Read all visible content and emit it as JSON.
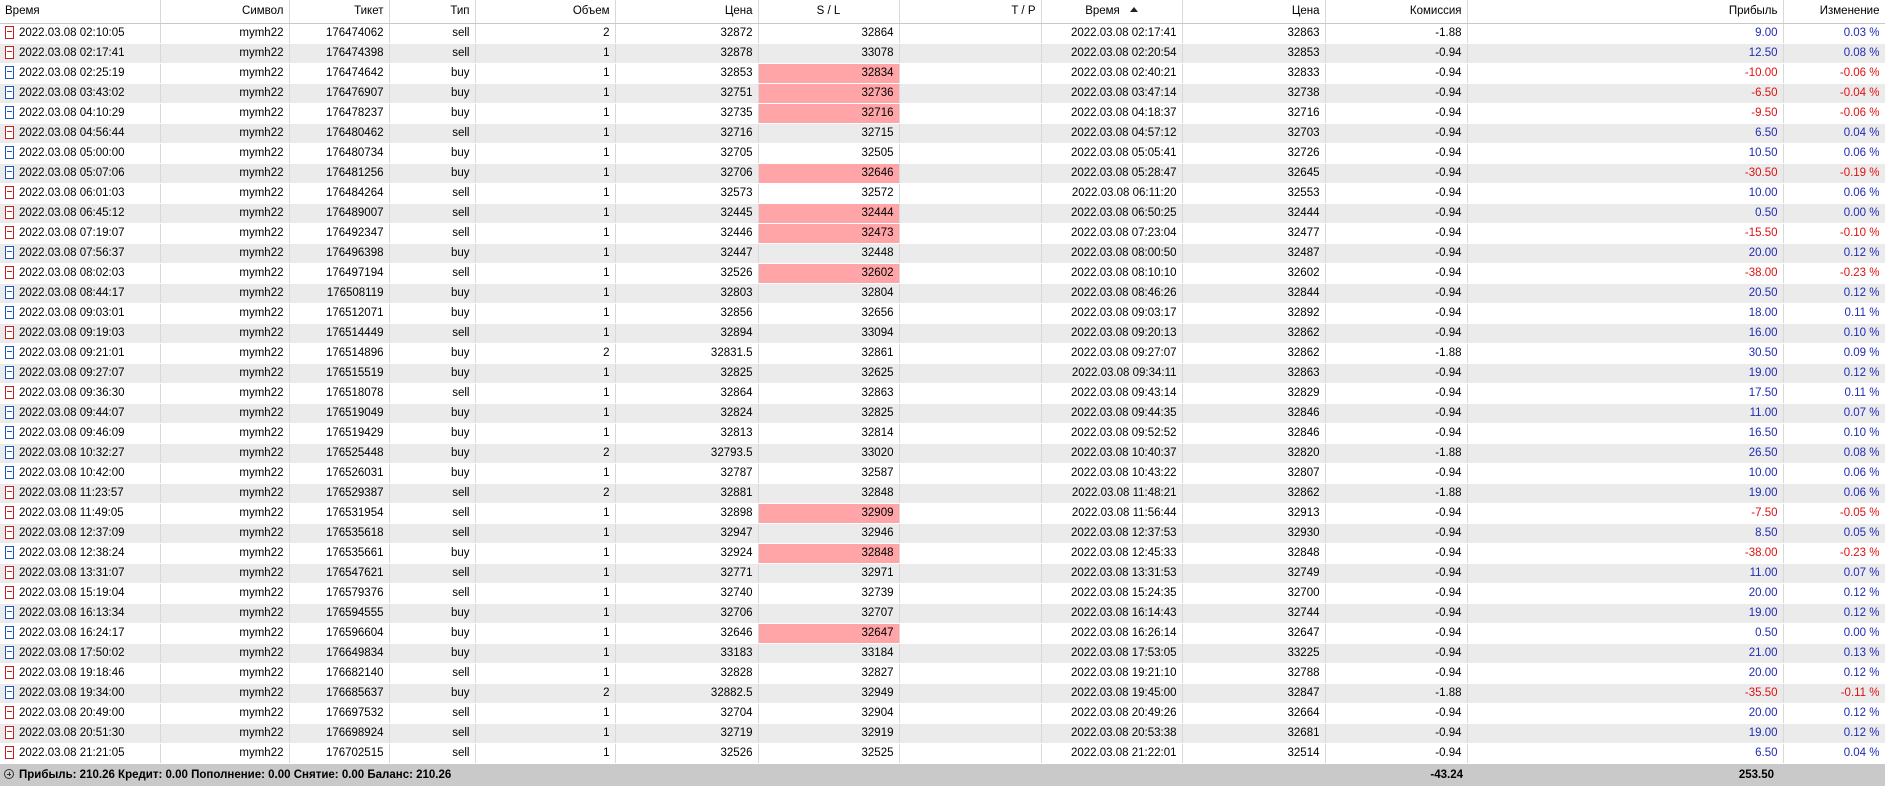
{
  "columns": [
    {
      "key": "open_time",
      "label": "Время"
    },
    {
      "key": "symbol",
      "label": "Символ"
    },
    {
      "key": "ticket",
      "label": "Тикет"
    },
    {
      "key": "type",
      "label": "Тип"
    },
    {
      "key": "volume",
      "label": "Объем"
    },
    {
      "key": "open_price",
      "label": "Цена"
    },
    {
      "key": "sl",
      "label": "S / L"
    },
    {
      "key": "tp",
      "label": "T / P"
    },
    {
      "key": "close_time",
      "label": "Время"
    },
    {
      "key": "close_price",
      "label": "Цена"
    },
    {
      "key": "commission",
      "label": "Комиссия"
    },
    {
      "key": "profit",
      "label": "Прибыль"
    },
    {
      "key": "change",
      "label": "Изменение"
    }
  ],
  "colors": {
    "sl_hit": "#ffa5a8",
    "profit_pos": "#1f2bb4",
    "profit_neg": "#e01010",
    "sell_icon": "#c32121",
    "buy_icon": "#1d55b8"
  },
  "rows": [
    [
      "2022.03.08 02:10:05",
      "mymh22",
      "176474062",
      "sell",
      "2",
      "32872",
      "32864",
      "",
      "2022.03.08 02:17:41",
      "32863",
      "-1.88",
      "9.00",
      "0.03 %",
      false
    ],
    [
      "2022.03.08 02:17:41",
      "mymh22",
      "176474398",
      "sell",
      "1",
      "32878",
      "33078",
      "",
      "2022.03.08 02:20:54",
      "32853",
      "-0.94",
      "12.50",
      "0.08 %",
      false
    ],
    [
      "2022.03.08 02:25:19",
      "mymh22",
      "176474642",
      "buy",
      "1",
      "32853",
      "32834",
      "",
      "2022.03.08 02:40:21",
      "32833",
      "-0.94",
      "-10.00",
      "-0.06 %",
      true
    ],
    [
      "2022.03.08 03:43:02",
      "mymh22",
      "176476907",
      "buy",
      "1",
      "32751",
      "32736",
      "",
      "2022.03.08 03:47:14",
      "32738",
      "-0.94",
      "-6.50",
      "-0.04 %",
      true
    ],
    [
      "2022.03.08 04:10:29",
      "mymh22",
      "176478237",
      "buy",
      "1",
      "32735",
      "32716",
      "",
      "2022.03.08 04:18:37",
      "32716",
      "-0.94",
      "-9.50",
      "-0.06 %",
      true
    ],
    [
      "2022.03.08 04:56:44",
      "mymh22",
      "176480462",
      "sell",
      "1",
      "32716",
      "32715",
      "",
      "2022.03.08 04:57:12",
      "32703",
      "-0.94",
      "6.50",
      "0.04 %",
      false
    ],
    [
      "2022.03.08 05:00:00",
      "mymh22",
      "176480734",
      "buy",
      "1",
      "32705",
      "32505",
      "",
      "2022.03.08 05:05:41",
      "32726",
      "-0.94",
      "10.50",
      "0.06 %",
      false
    ],
    [
      "2022.03.08 05:07:06",
      "mymh22",
      "176481256",
      "buy",
      "1",
      "32706",
      "32646",
      "",
      "2022.03.08 05:28:47",
      "32645",
      "-0.94",
      "-30.50",
      "-0.19 %",
      true
    ],
    [
      "2022.03.08 06:01:03",
      "mymh22",
      "176484264",
      "sell",
      "1",
      "32573",
      "32572",
      "",
      "2022.03.08 06:11:20",
      "32553",
      "-0.94",
      "10.00",
      "0.06 %",
      false
    ],
    [
      "2022.03.08 06:45:12",
      "mymh22",
      "176489007",
      "sell",
      "1",
      "32445",
      "32444",
      "",
      "2022.03.08 06:50:25",
      "32444",
      "-0.94",
      "0.50",
      "0.00 %",
      true
    ],
    [
      "2022.03.08 07:19:07",
      "mymh22",
      "176492347",
      "sell",
      "1",
      "32446",
      "32473",
      "",
      "2022.03.08 07:23:04",
      "32477",
      "-0.94",
      "-15.50",
      "-0.10 %",
      true
    ],
    [
      "2022.03.08 07:56:37",
      "mymh22",
      "176496398",
      "buy",
      "1",
      "32447",
      "32448",
      "",
      "2022.03.08 08:00:50",
      "32487",
      "-0.94",
      "20.00",
      "0.12 %",
      false
    ],
    [
      "2022.03.08 08:02:03",
      "mymh22",
      "176497194",
      "sell",
      "1",
      "32526",
      "32602",
      "",
      "2022.03.08 08:10:10",
      "32602",
      "-0.94",
      "-38.00",
      "-0.23 %",
      true
    ],
    [
      "2022.03.08 08:44:17",
      "mymh22",
      "176508119",
      "buy",
      "1",
      "32803",
      "32804",
      "",
      "2022.03.08 08:46:26",
      "32844",
      "-0.94",
      "20.50",
      "0.12 %",
      false
    ],
    [
      "2022.03.08 09:03:01",
      "mymh22",
      "176512071",
      "buy",
      "1",
      "32856",
      "32656",
      "",
      "2022.03.08 09:03:17",
      "32892",
      "-0.94",
      "18.00",
      "0.11 %",
      false
    ],
    [
      "2022.03.08 09:19:03",
      "mymh22",
      "176514449",
      "sell",
      "1",
      "32894",
      "33094",
      "",
      "2022.03.08 09:20:13",
      "32862",
      "-0.94",
      "16.00",
      "0.10 %",
      false
    ],
    [
      "2022.03.08 09:21:01",
      "mymh22",
      "176514896",
      "buy",
      "2",
      "32831.5",
      "32861",
      "",
      "2022.03.08 09:27:07",
      "32862",
      "-1.88",
      "30.50",
      "0.09 %",
      false
    ],
    [
      "2022.03.08 09:27:07",
      "mymh22",
      "176515519",
      "buy",
      "1",
      "32825",
      "32625",
      "",
      "2022.03.08 09:34:11",
      "32863",
      "-0.94",
      "19.00",
      "0.12 %",
      false
    ],
    [
      "2022.03.08 09:36:30",
      "mymh22",
      "176518078",
      "sell",
      "1",
      "32864",
      "32863",
      "",
      "2022.03.08 09:43:14",
      "32829",
      "-0.94",
      "17.50",
      "0.11 %",
      false
    ],
    [
      "2022.03.08 09:44:07",
      "mymh22",
      "176519049",
      "buy",
      "1",
      "32824",
      "32825",
      "",
      "2022.03.08 09:44:35",
      "32846",
      "-0.94",
      "11.00",
      "0.07 %",
      false
    ],
    [
      "2022.03.08 09:46:09",
      "mymh22",
      "176519429",
      "buy",
      "1",
      "32813",
      "32814",
      "",
      "2022.03.08 09:52:52",
      "32846",
      "-0.94",
      "16.50",
      "0.10 %",
      false
    ],
    [
      "2022.03.08 10:32:27",
      "mymh22",
      "176525448",
      "buy",
      "2",
      "32793.5",
      "33020",
      "",
      "2022.03.08 10:40:37",
      "32820",
      "-1.88",
      "26.50",
      "0.08 %",
      false
    ],
    [
      "2022.03.08 10:42:00",
      "mymh22",
      "176526031",
      "buy",
      "1",
      "32787",
      "32587",
      "",
      "2022.03.08 10:43:22",
      "32807",
      "-0.94",
      "10.00",
      "0.06 %",
      false
    ],
    [
      "2022.03.08 11:23:57",
      "mymh22",
      "176529387",
      "sell",
      "2",
      "32881",
      "32848",
      "",
      "2022.03.08 11:48:21",
      "32862",
      "-1.88",
      "19.00",
      "0.06 %",
      false
    ],
    [
      "2022.03.08 11:49:05",
      "mymh22",
      "176531954",
      "sell",
      "1",
      "32898",
      "32909",
      "",
      "2022.03.08 11:56:44",
      "32913",
      "-0.94",
      "-7.50",
      "-0.05 %",
      true
    ],
    [
      "2022.03.08 12:37:09",
      "mymh22",
      "176535618",
      "sell",
      "1",
      "32947",
      "32946",
      "",
      "2022.03.08 12:37:53",
      "32930",
      "-0.94",
      "8.50",
      "0.05 %",
      false
    ],
    [
      "2022.03.08 12:38:24",
      "mymh22",
      "176535661",
      "buy",
      "1",
      "32924",
      "32848",
      "",
      "2022.03.08 12:45:33",
      "32848",
      "-0.94",
      "-38.00",
      "-0.23 %",
      true
    ],
    [
      "2022.03.08 13:31:07",
      "mymh22",
      "176547621",
      "sell",
      "1",
      "32771",
      "32971",
      "",
      "2022.03.08 13:31:53",
      "32749",
      "-0.94",
      "11.00",
      "0.07 %",
      false
    ],
    [
      "2022.03.08 15:19:04",
      "mymh22",
      "176579376",
      "sell",
      "1",
      "32740",
      "32739",
      "",
      "2022.03.08 15:24:35",
      "32700",
      "-0.94",
      "20.00",
      "0.12 %",
      false
    ],
    [
      "2022.03.08 16:13:34",
      "mymh22",
      "176594555",
      "buy",
      "1",
      "32706",
      "32707",
      "",
      "2022.03.08 16:14:43",
      "32744",
      "-0.94",
      "19.00",
      "0.12 %",
      false
    ],
    [
      "2022.03.08 16:24:17",
      "mymh22",
      "176596604",
      "buy",
      "1",
      "32646",
      "32647",
      "",
      "2022.03.08 16:26:14",
      "32647",
      "-0.94",
      "0.50",
      "0.00 %",
      true
    ],
    [
      "2022.03.08 17:50:02",
      "mymh22",
      "176649834",
      "buy",
      "1",
      "33183",
      "33184",
      "",
      "2022.03.08 17:53:05",
      "33225",
      "-0.94",
      "21.00",
      "0.13 %",
      false
    ],
    [
      "2022.03.08 19:18:46",
      "mymh22",
      "176682140",
      "sell",
      "1",
      "32828",
      "32827",
      "",
      "2022.03.08 19:21:10",
      "32788",
      "-0.94",
      "20.00",
      "0.12 %",
      false
    ],
    [
      "2022.03.08 19:34:00",
      "mymh22",
      "176685637",
      "buy",
      "2",
      "32882.5",
      "32949",
      "",
      "2022.03.08 19:45:00",
      "32847",
      "-1.88",
      "-35.50",
      "-0.11 %",
      false
    ],
    [
      "2022.03.08 20:49:00",
      "mymh22",
      "176697532",
      "sell",
      "1",
      "32704",
      "32904",
      "",
      "2022.03.08 20:49:26",
      "32664",
      "-0.94",
      "20.00",
      "0.12 %",
      false
    ],
    [
      "2022.03.08 20:51:30",
      "mymh22",
      "176698924",
      "sell",
      "1",
      "32719",
      "32919",
      "",
      "2022.03.08 20:53:38",
      "32681",
      "-0.94",
      "19.00",
      "0.12 %",
      false
    ],
    [
      "2022.03.08 21:21:05",
      "mymh22",
      "176702515",
      "sell",
      "1",
      "32526",
      "32525",
      "",
      "2022.03.08 21:22:01",
      "32514",
      "-0.94",
      "6.50",
      "0.04 %",
      false
    ]
  ],
  "footer": {
    "summary": "Прибыль: 210.26  Кредит: 0.00  Пополнение: 0.00  Снятие: 0.00  Баланс: 210.26",
    "commission_total": "-43.24",
    "profit_total": "253.50"
  }
}
